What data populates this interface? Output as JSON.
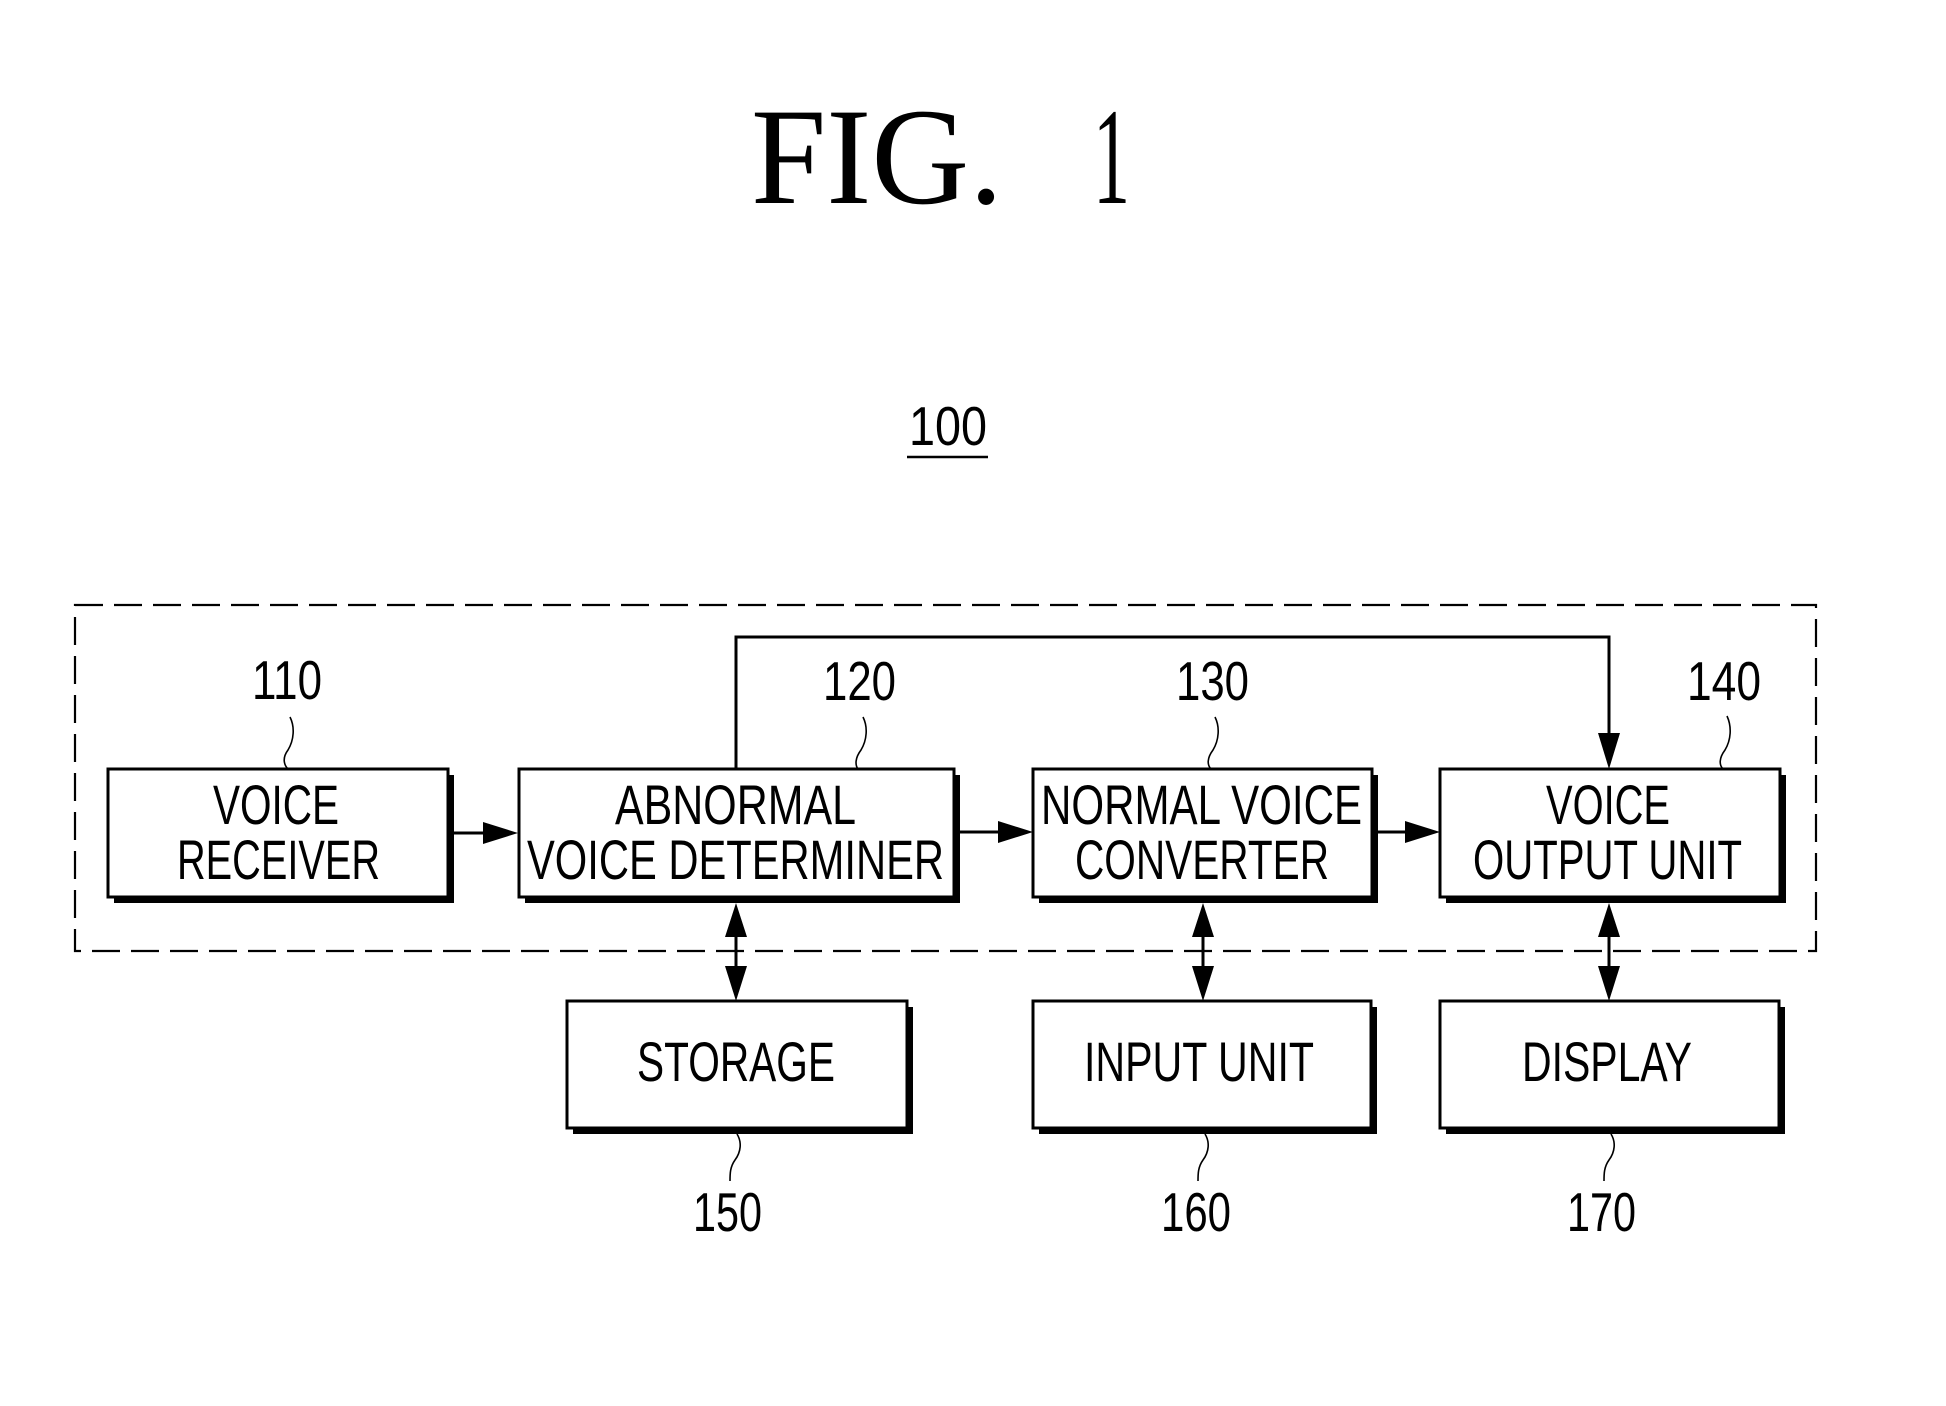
{
  "figure": {
    "prefix": "FIG.",
    "number": "1",
    "system_ref": "100"
  },
  "blocks": {
    "voice_receiver": {
      "ref": "110",
      "line1": "VOICE",
      "line2": "RECEIVER"
    },
    "abnormal_voice_determiner": {
      "ref": "120",
      "line1": "ABNORMAL",
      "line2": "VOICE DETERMINER"
    },
    "normal_voice_converter": {
      "ref": "130",
      "line1": "NORMAL VOICE",
      "line2": "CONVERTER"
    },
    "voice_output_unit": {
      "ref": "140",
      "line1": "VOICE",
      "line2": "OUTPUT UNIT"
    },
    "storage": {
      "ref": "150",
      "line1": "STORAGE"
    },
    "input_unit": {
      "ref": "160",
      "line1": "INPUT UNIT"
    },
    "display": {
      "ref": "170",
      "line1": "DISPLAY"
    }
  },
  "group": {
    "ref": "100",
    "members": [
      "110",
      "120",
      "130",
      "140"
    ],
    "style": "dashed"
  },
  "connections": [
    {
      "from": "110",
      "to": "120",
      "direction": "one-way"
    },
    {
      "from": "120",
      "to": "130",
      "direction": "one-way"
    },
    {
      "from": "130",
      "to": "140",
      "direction": "one-way"
    },
    {
      "from": "120",
      "to": "140",
      "direction": "one-way",
      "route": "over-top"
    },
    {
      "from": "120",
      "to": "150",
      "direction": "two-way"
    },
    {
      "from": "130",
      "to": "160",
      "direction": "two-way"
    },
    {
      "from": "140",
      "to": "170",
      "direction": "two-way"
    }
  ]
}
